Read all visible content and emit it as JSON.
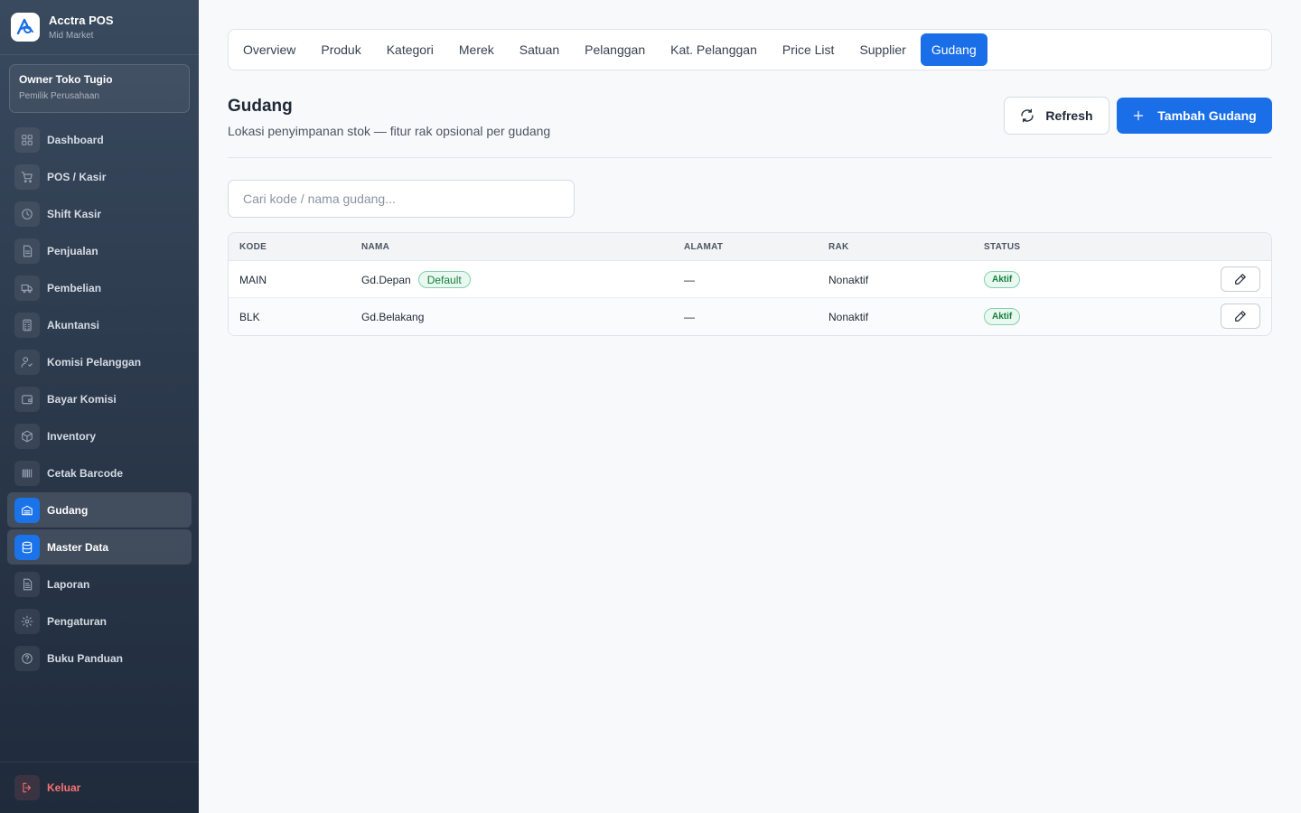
{
  "brand": {
    "title": "Acctra POS",
    "subtitle": "Mid Market"
  },
  "owner": {
    "name": "Owner Toko Tugio",
    "role": "Pemilik Perusahaan"
  },
  "sidebar": {
    "items": [
      {
        "label": "Dashboard",
        "icon": "dashboard-icon"
      },
      {
        "label": "POS / Kasir",
        "icon": "cart-icon"
      },
      {
        "label": "Shift Kasir",
        "icon": "clock-icon"
      },
      {
        "label": "Penjualan",
        "icon": "document-icon"
      },
      {
        "label": "Pembelian",
        "icon": "truck-icon"
      },
      {
        "label": "Akuntansi",
        "icon": "calculator-icon"
      },
      {
        "label": "Komisi Pelanggan",
        "icon": "user-commission-icon"
      },
      {
        "label": "Bayar Komisi",
        "icon": "wallet-icon"
      },
      {
        "label": "Inventory",
        "icon": "box-icon"
      },
      {
        "label": "Cetak Barcode",
        "icon": "barcode-icon"
      },
      {
        "label": "Gudang",
        "icon": "warehouse-icon",
        "active": true
      },
      {
        "label": "Master Data",
        "icon": "database-icon",
        "active": true
      },
      {
        "label": "Laporan",
        "icon": "report-icon"
      },
      {
        "label": "Pengaturan",
        "icon": "gear-icon"
      },
      {
        "label": "Buku Panduan",
        "icon": "help-icon"
      }
    ],
    "logout_label": "Keluar"
  },
  "tabs": [
    "Overview",
    "Produk",
    "Kategori",
    "Merek",
    "Satuan",
    "Pelanggan",
    "Kat. Pelanggan",
    "Price List",
    "Supplier",
    "Gudang"
  ],
  "active_tab": "Gudang",
  "header": {
    "title": "Gudang",
    "subtitle": "Lokasi penyimpanan stok — fitur rak opsional per gudang",
    "refresh_label": "Refresh",
    "add_label": "Tambah Gudang"
  },
  "search": {
    "placeholder": "Cari kode / nama gudang...",
    "value": ""
  },
  "table": {
    "columns": {
      "kode": "KODE",
      "nama": "NAMA",
      "alamat": "ALAMAT",
      "rak": "RAK",
      "status": "STATUS"
    },
    "rows": [
      {
        "kode": "MAIN",
        "nama": "Gd.Depan",
        "badge": "Default",
        "alamat": "—",
        "rak": "Nonaktif",
        "status": "Aktif"
      },
      {
        "kode": "BLK",
        "nama": "Gd.Belakang",
        "badge": "",
        "alamat": "—",
        "rak": "Nonaktif",
        "status": "Aktif"
      }
    ]
  },
  "colors": {
    "accent": "#1a6fe8",
    "sidebar_top": "#3a4a5e",
    "sidebar_bottom": "#1f2b3b",
    "success": "#15803d",
    "danger": "#f87171"
  }
}
